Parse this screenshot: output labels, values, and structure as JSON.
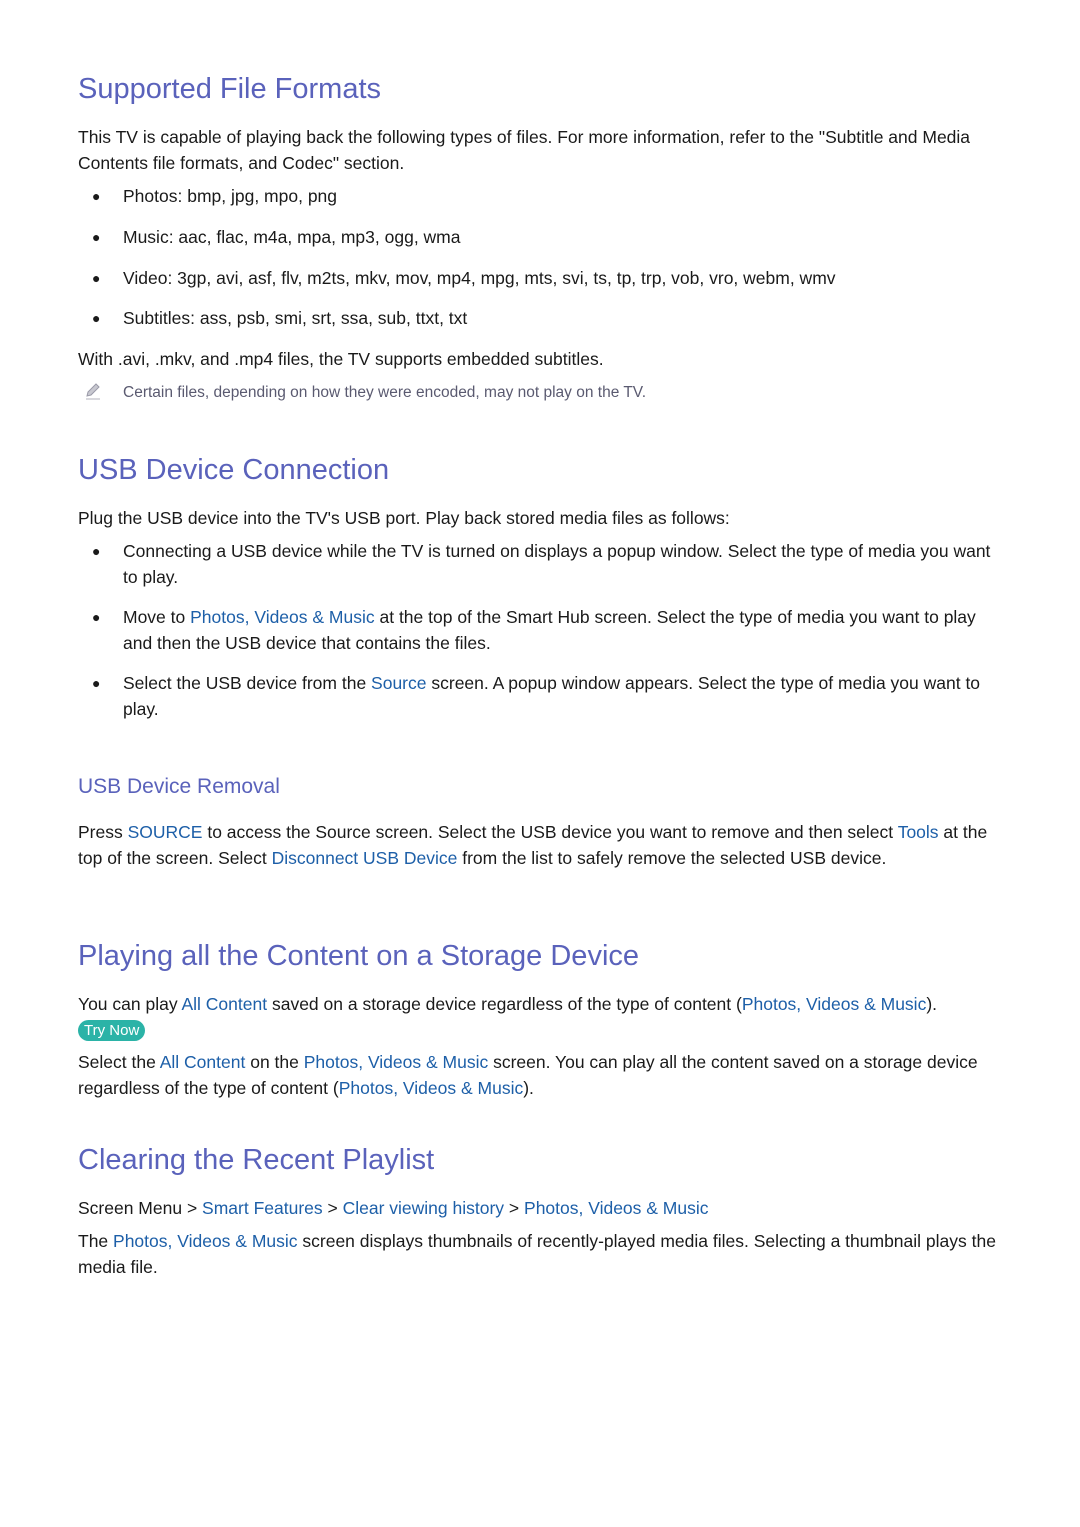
{
  "sections": {
    "formats": {
      "title": "Supported File Formats",
      "intro": "This TV is capable of playing back the following types of files. For more information, refer to the \"Subtitle and Media Contents file formats, and Codec\" section.",
      "bullets": [
        "Photos: bmp, jpg, mpo, png",
        "Music: aac, flac, m4a, mpa, mp3, ogg, wma",
        "Video: 3gp, avi, asf, flv, m2ts, mkv, mov, mp4, mpg, mts, svi, ts, tp, trp, vob, vro, webm, wmv",
        "Subtitles: ass, psb, smi, srt, ssa, sub, ttxt, txt"
      ],
      "outro": "With .avi, .mkv, and .mp4 files, the TV supports embedded subtitles.",
      "note": "Certain files, depending on how they were encoded, may not play on the TV."
    },
    "usb": {
      "title": "USB Device Connection",
      "intro": "Plug the USB device into the TV's USB port. Play back stored media files as follows:",
      "b1": "Connecting a USB device while the TV is turned on displays a popup window. Select the type of media you want to play.",
      "b2_pre": "Move to ",
      "b2_link": "Photos, Videos & Music",
      "b2_post": " at the top of the Smart Hub screen. Select the type of media you want to play and then the USB device that contains the files.",
      "b3_pre": "Select the USB device from the ",
      "b3_link": "Source",
      "b3_post": " screen. A popup window appears. Select the type of media you want to play."
    },
    "removal": {
      "title": "USB Device Removal",
      "t1": "Press ",
      "l1": "SOURCE",
      "t2": " to access the Source screen. Select the USB device you want to remove and then select ",
      "l2": "Tools",
      "t3": " at the top of the screen. Select ",
      "l3": "Disconnect USB Device",
      "t4": " from the list to safely remove the selected USB device."
    },
    "playing": {
      "title": "Playing all the Content on a Storage Device",
      "p1_t1": "You can play ",
      "p1_l1": "All Content",
      "p1_t2": " saved on a storage device regardless of the type of content (",
      "p1_l2": "Photos, Videos & Music",
      "p1_t3": "). ",
      "try_now": "Try Now",
      "p2_t1": "Select the ",
      "p2_l1": "All Content",
      "p2_t2": " on the ",
      "p2_l2": "Photos, Videos & Music",
      "p2_t3": " screen. You can play all the content saved on a storage device regardless of the type of content (",
      "p2_l3": "Photos, Videos & Music",
      "p2_t4": ")."
    },
    "clearing": {
      "title": "Clearing the Recent Playlist",
      "path": [
        "Screen Menu",
        "Smart Features",
        "Clear viewing history",
        "Photos, Videos & Music"
      ],
      "sep": " > ",
      "p_t1": "The ",
      "p_l1": "Photos, Videos & Music",
      "p_t2": " screen displays thumbnails of recently-played media files. Selecting a thumbnail plays the media file."
    }
  }
}
